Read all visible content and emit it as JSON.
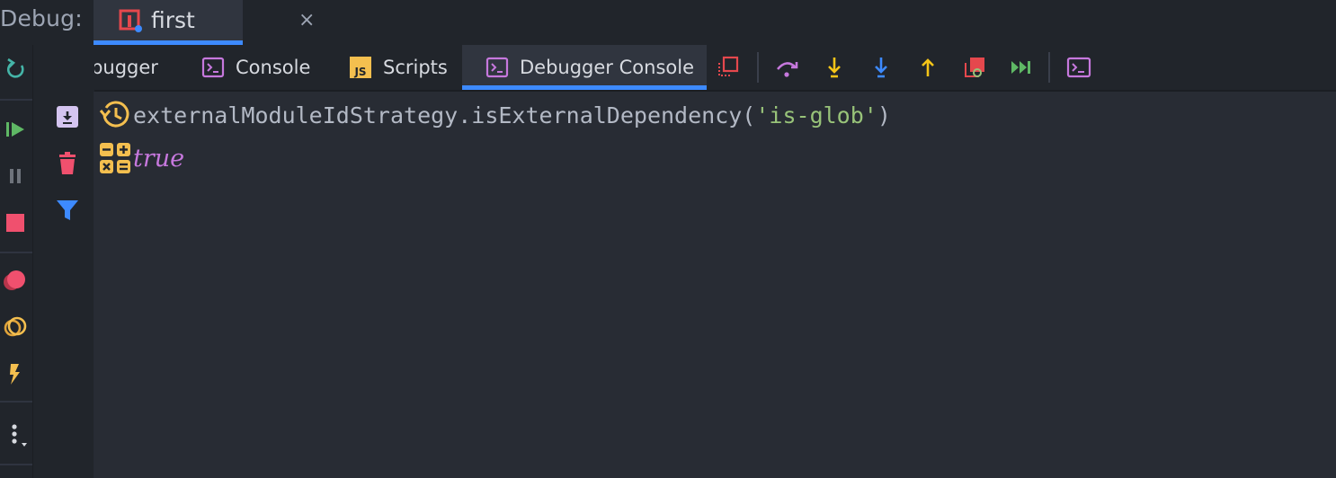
{
  "debug_bar": {
    "label": "Debug:",
    "run_tab": {
      "label": "first",
      "icon": "npm-run-icon",
      "close_glyph": "×"
    }
  },
  "tabs": [
    {
      "label": "Debugger",
      "icon": null,
      "active": false
    },
    {
      "label": "Console",
      "icon": "console-icon",
      "active": false
    },
    {
      "label": "Scripts",
      "icon": "js-file-icon",
      "active": false
    },
    {
      "label": "Debugger Console",
      "icon": "console-icon",
      "active": true
    }
  ],
  "toolbar_icons": [
    "show-execution-point-icon",
    "step-over-icon",
    "step-into-icon",
    "force-step-into-icon",
    "step-out-icon",
    "drop-frame-icon",
    "run-to-cursor-icon",
    "evaluate-expression-icon"
  ],
  "left_toolbar_icons": [
    "rerun-icon",
    "resume-icon",
    "pause-icon",
    "stop-icon",
    "view-breakpoints-icon",
    "mute-breakpoints-icon",
    "lightning-icon",
    "more-icon"
  ],
  "console_toolbar_icons": [
    "scroll-to-end-icon",
    "clear-all-icon",
    "filter-icon"
  ],
  "console": {
    "lines": [
      {
        "kind": "input",
        "icon": "history-icon",
        "prefix": "externalModuleIdStrategy.isExternalDependency(",
        "string": "'is-glob'",
        "suffix": ")"
      },
      {
        "kind": "output",
        "icon": "calculator-icon",
        "value": "true"
      }
    ]
  },
  "colors": {
    "background": "#282c34",
    "panel": "#21252b",
    "accent": "#3d8aff",
    "string": "#98c379",
    "keyword": "#c678dd"
  }
}
